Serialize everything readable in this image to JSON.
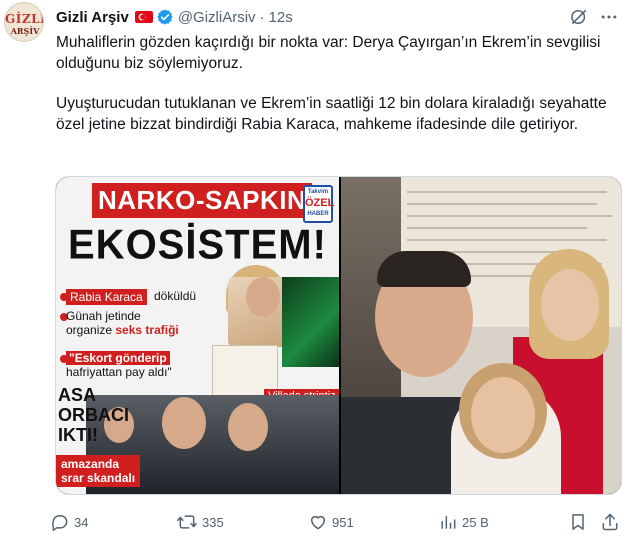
{
  "tweet": {
    "author": {
      "display_name": "Gizli Arşiv",
      "handle": "@GizliArsiv",
      "avatar_text": "GİZLİ",
      "avatar_sub": "ARŞİV"
    },
    "time": "12s",
    "paragraphs": [
      "Muhaliflerin gözden kaçırdığı bir nokta var: Derya Çayırgan’ın Ekrem’in sevgilisi olduğunu biz söylemiyoruz.",
      "Uyuşturucudan tutuklanan ve Ekrem’in saatliği 12 bin dolara kiraladığı seyahatte özel jetine bizzat bindirdiği Rabia Karaca, mahkeme ifadesinde dile getiriyor."
    ],
    "media": {
      "left": {
        "banner": "NARKO-SAPKIN",
        "headline": "EKOSİSTEM!",
        "badge_top": "Takvim",
        "badge_mid": "ÖZEL",
        "badge_bot": "HABER",
        "rabia_tag": "Rabia Karaca",
        "rabia_rest": "döküldü",
        "gunah_line1": "Günah jetinde",
        "gunah_line2_pre": "organize ",
        "gunah_line2_bold": "seks trafiği",
        "eskort_line1": "\"Eskort gönderip",
        "eskort_line2": "hafriyattan pay aldı\"",
        "asa_line1": "ASA",
        "asa_line2": "ORBACI",
        "asa_line3": "IKTI!",
        "skandal_line1": "amazanda",
        "skandal_line2": "srar skandalı",
        "villada": "Villada striptiz"
      }
    },
    "stats": {
      "replies": "34",
      "retweets": "335",
      "likes": "951",
      "views": "25 B"
    }
  }
}
